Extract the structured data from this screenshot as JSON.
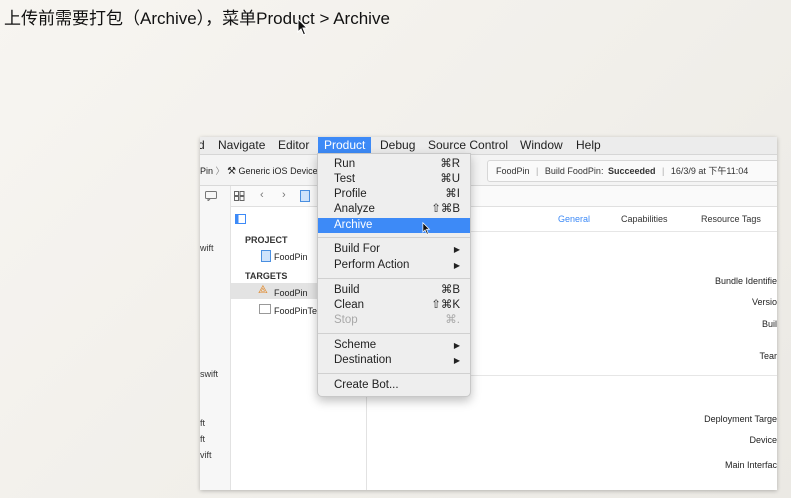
{
  "caption": "上传前需要打包（Archive），菜单Product > Archive",
  "menubar": {
    "items": [
      "d",
      "Navigate",
      "Editor",
      "Product",
      "Debug",
      "Source Control",
      "Window",
      "Help"
    ]
  },
  "toolbar": {
    "scheme_prefix": "Pin",
    "device": "Generic iOS Device",
    "status_app": "FoodPin",
    "status_build_prefix": "Build FoodPin:",
    "status_build_result": "Succeeded",
    "status_time": "16/3/9 at 下午11:04"
  },
  "sidebar": {
    "files": [
      "wift",
      "swift",
      "ft",
      "ft",
      "vift"
    ]
  },
  "outline": {
    "project_header": "PROJECT",
    "project_item": "FoodPin",
    "targets_header": "TARGETS",
    "target_items": [
      "FoodPin",
      "FoodPinTe"
    ]
  },
  "tabs": [
    "General",
    "Capabilities",
    "Resource Tags"
  ],
  "right_labels": [
    "Bundle Identifie",
    "Versio",
    "Buil",
    "Tear",
    "Deployment Targe",
    "Device",
    "Main Interfac"
  ],
  "product_menu": {
    "items": [
      {
        "label": "Run",
        "shortcut": "⌘R",
        "state": "normal"
      },
      {
        "label": "Test",
        "shortcut": "⌘U",
        "state": "normal"
      },
      {
        "label": "Profile",
        "shortcut": "⌘I",
        "state": "normal"
      },
      {
        "label": "Analyze",
        "shortcut": "⇧⌘B",
        "state": "normal"
      },
      {
        "label": "Archive",
        "shortcut": "",
        "state": "highlighted"
      },
      {
        "label": "Build For",
        "shortcut": "▶",
        "state": "normal"
      },
      {
        "label": "Perform Action",
        "shortcut": "▶",
        "state": "normal"
      },
      {
        "label": "Build",
        "shortcut": "⌘B",
        "state": "normal"
      },
      {
        "label": "Clean",
        "shortcut": "⇧⌘K",
        "state": "normal"
      },
      {
        "label": "Stop",
        "shortcut": "⌘.",
        "state": "disabled"
      },
      {
        "label": "Scheme",
        "shortcut": "▶",
        "state": "normal"
      },
      {
        "label": "Destination",
        "shortcut": "▶",
        "state": "normal"
      },
      {
        "label": "Create Bot...",
        "shortcut": "",
        "state": "normal"
      }
    ]
  },
  "colors": {
    "accent": "#3d8af7",
    "menu_bg": "#eeeeee",
    "tab_active": "#3d8af7"
  }
}
